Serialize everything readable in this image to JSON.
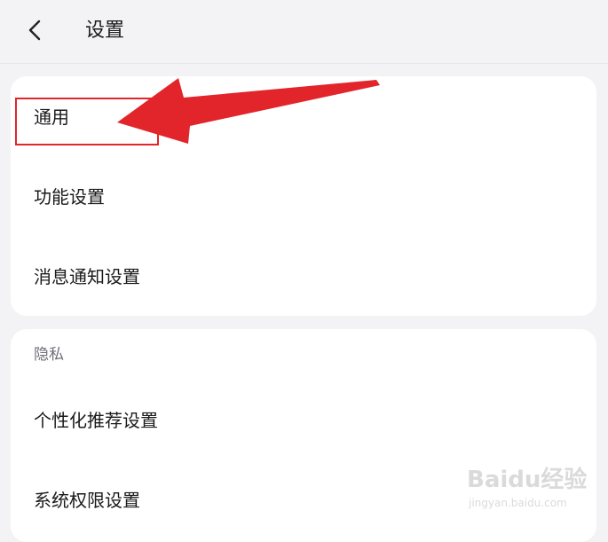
{
  "header": {
    "back_icon": "chevron-left-icon",
    "title": "设置"
  },
  "group_general": {
    "items": [
      {
        "label": "通用"
      },
      {
        "label": "功能设置"
      },
      {
        "label": "消息通知设置"
      }
    ]
  },
  "group_privacy": {
    "title": "隐私",
    "items": [
      {
        "label": "个性化推荐设置"
      },
      {
        "label": "系统权限设置"
      }
    ]
  },
  "annotation": {
    "color": "#e1252b",
    "arrow_icon": "red-arrow-pointer",
    "highlight": "通用"
  },
  "watermark": {
    "logo": "Baidu经验",
    "url": "jingyan.baidu.com"
  }
}
